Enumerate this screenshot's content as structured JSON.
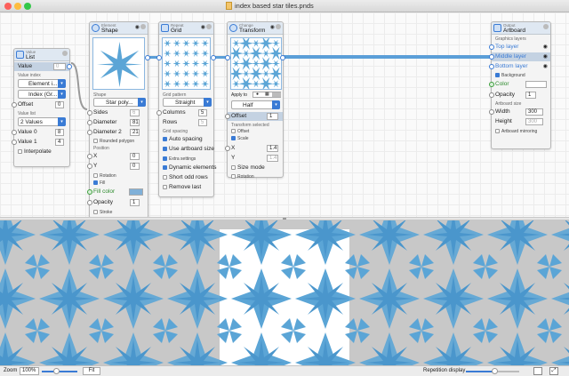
{
  "window": {
    "title": "index based star tiles.pnds"
  },
  "colors": {
    "accent": "#3a7bd5",
    "star": "#5ba5d6",
    "tile_grey": "#c8c8c8"
  },
  "value_node": {
    "category": "Value",
    "name": "List",
    "value_label": "Value",
    "value_placeholder": "0",
    "value_index_label": "Value index",
    "element_select": "Element i...",
    "index_select": "Index (Gr...",
    "offset_label": "Offset",
    "offset_value": "0",
    "value_list_label": "Value list",
    "values_select": "2 Values",
    "value0_label": "Value 0",
    "value0": "8",
    "value1_label": "Value 1",
    "value1": "4",
    "interpolate": "Interpolate"
  },
  "shape_node": {
    "category": "Element",
    "name": "Shape",
    "shape_label": "Shape",
    "shape_select": "Star poly...",
    "sides_label": "Sides",
    "sides": "6",
    "diameter_label": "Diameter",
    "diameter": "81",
    "diameter2_label": "Diameter 2",
    "diameter2": "21",
    "rounded": "Rounded polygon",
    "position_label": "Position",
    "x_label": "X",
    "x": "0",
    "y_label": "Y",
    "y": "0",
    "rotation": "Rotation",
    "fill": "Fill",
    "fill_color": "Fill color",
    "opacity_label": "Opacity",
    "opacity": "1",
    "stroke": "Stroke"
  },
  "grid_node": {
    "category": "Repeat",
    "name": "Grid",
    "pattern_label": "Grid pattern",
    "pattern_select": "Straight",
    "columns_label": "Columns",
    "columns": "5",
    "rows_label": "Rows",
    "rows": "5",
    "spacing_label": "Grid spacing",
    "auto_spacing": "Auto spacing",
    "use_artboard": "Use artboard size",
    "extra_label": "Extra settings",
    "dynamic": "Dynamic elements",
    "short_odd": "Short odd rows",
    "remove_last": "Remove last"
  },
  "transform_node": {
    "category": "Change",
    "name": "Transform",
    "apply_to": "Apply to",
    "half_select": "Half",
    "offset_label": "Offset",
    "offset": "1",
    "selected_label": "Transform selected",
    "offset_cb": "Offset",
    "scale_cb": "Scale",
    "x_label": "X",
    "x": "1.4",
    "y_label": "Y",
    "y": "1.4",
    "size_mode": "Size mode",
    "rotation_cb": "Rotation"
  },
  "artboard_node": {
    "category": "Output",
    "name": "Artboard",
    "layers_label": "Graphics layers",
    "layers": [
      "Top layer",
      "Middle layer",
      "Bottom layer"
    ],
    "background_cb": "Background",
    "color_label": "Color",
    "opacity_label": "Opacity",
    "opacity": "1",
    "size_label": "Artboard size",
    "width_label": "Width",
    "width": "300",
    "height_label": "Height",
    "height": "300",
    "mirroring": "Artboard mirroring"
  },
  "status": {
    "zoom_label": "Zoom",
    "zoom_value": "100%",
    "fit_label": "Fit",
    "repetition_label": "Repetition display"
  }
}
